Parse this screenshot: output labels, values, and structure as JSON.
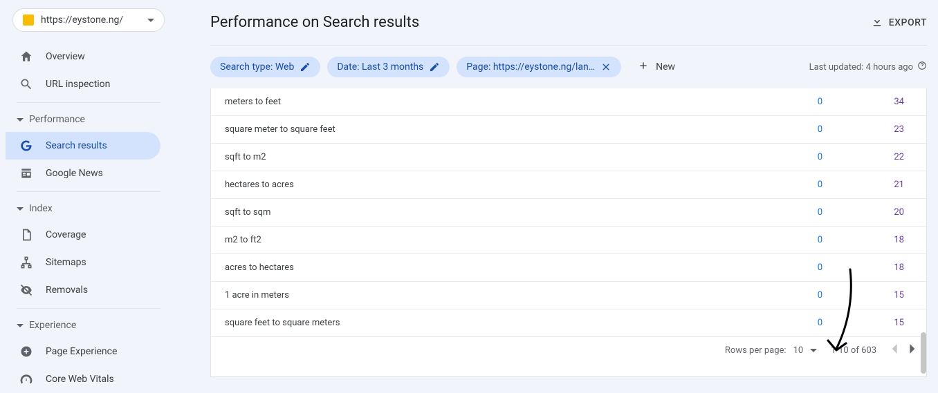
{
  "site_selector": {
    "url": "https://eystone.ng/"
  },
  "sidebar": {
    "top": [
      {
        "label": "Overview",
        "icon": "home"
      },
      {
        "label": "URL inspection",
        "icon": "search"
      }
    ],
    "sections": [
      {
        "title": "Performance",
        "items": [
          {
            "label": "Search results",
            "icon": "google",
            "active": true
          },
          {
            "label": "Google News",
            "icon": "news"
          }
        ]
      },
      {
        "title": "Index",
        "items": [
          {
            "label": "Coverage",
            "icon": "coverage"
          },
          {
            "label": "Sitemaps",
            "icon": "sitemaps"
          },
          {
            "label": "Removals",
            "icon": "removals"
          }
        ]
      },
      {
        "title": "Experience",
        "items": [
          {
            "label": "Page Experience",
            "icon": "pageexp"
          },
          {
            "label": "Core Web Vitals",
            "icon": "speed"
          }
        ]
      }
    ]
  },
  "header": {
    "title": "Performance on Search results",
    "export_label": "EXPORT"
  },
  "filters": {
    "chips": [
      {
        "label": "Search type: Web",
        "trailing": "edit"
      },
      {
        "label": "Date: Last 3 months",
        "trailing": "edit"
      },
      {
        "label": "Page: https://eystone.ng/lan…",
        "trailing": "close"
      }
    ],
    "new_label": "New",
    "last_updated": "Last updated: 4 hours ago"
  },
  "table": {
    "rows": [
      {
        "query": "meters to feet",
        "col1": "0",
        "col2": "34"
      },
      {
        "query": "square meter to square feet",
        "col1": "0",
        "col2": "23"
      },
      {
        "query": "sqft to m2",
        "col1": "0",
        "col2": "22"
      },
      {
        "query": "hectares to acres",
        "col1": "0",
        "col2": "21"
      },
      {
        "query": "sqft to sqm",
        "col1": "0",
        "col2": "20"
      },
      {
        "query": "m2 to ft2",
        "col1": "0",
        "col2": "18"
      },
      {
        "query": "acres to hectares",
        "col1": "0",
        "col2": "18"
      },
      {
        "query": "1 acre in meters",
        "col1": "0",
        "col2": "15"
      },
      {
        "query": "square feet to square meters",
        "col1": "0",
        "col2": "15"
      }
    ],
    "footer": {
      "rows_per_page_label": "Rows per page:",
      "rows_per_page_value": "10",
      "range": "1-10 of 603"
    }
  }
}
